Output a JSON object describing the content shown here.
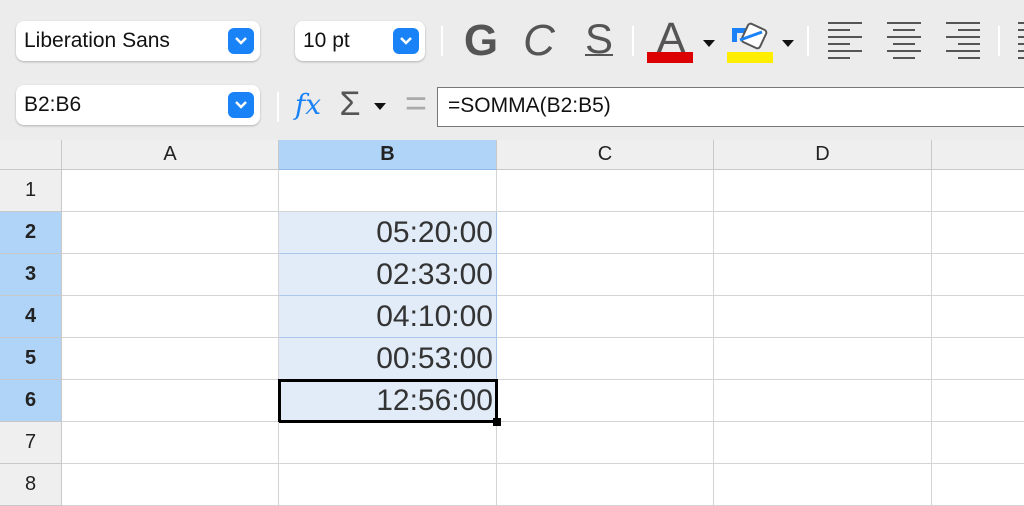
{
  "toolbar": {
    "font_name": "Liberation Sans",
    "font_size": "10 pt",
    "bold_label": "G",
    "italic_label": "C",
    "underline_label": "S",
    "font_color_label": "A",
    "font_color": "#dd0000",
    "highlight_color": "#ffee00"
  },
  "formula_bar": {
    "name_box": "B2:B6",
    "fx_label": "fx",
    "sum_label": "Σ",
    "equals_label": "=",
    "formula": "=SOMMA(B2:B5)"
  },
  "sheet": {
    "columns": [
      "A",
      "B",
      "C",
      "D"
    ],
    "rows": [
      "1",
      "2",
      "3",
      "4",
      "5",
      "6",
      "7",
      "8"
    ],
    "selected_column": "B",
    "selected_rows": [
      "2",
      "3",
      "4",
      "5",
      "6"
    ],
    "active_cell": "B6",
    "values": {
      "B2": "05:20:00",
      "B3": "02:33:00",
      "B4": "04:10:00",
      "B5": "00:53:00",
      "B6": "12:56:00"
    }
  }
}
